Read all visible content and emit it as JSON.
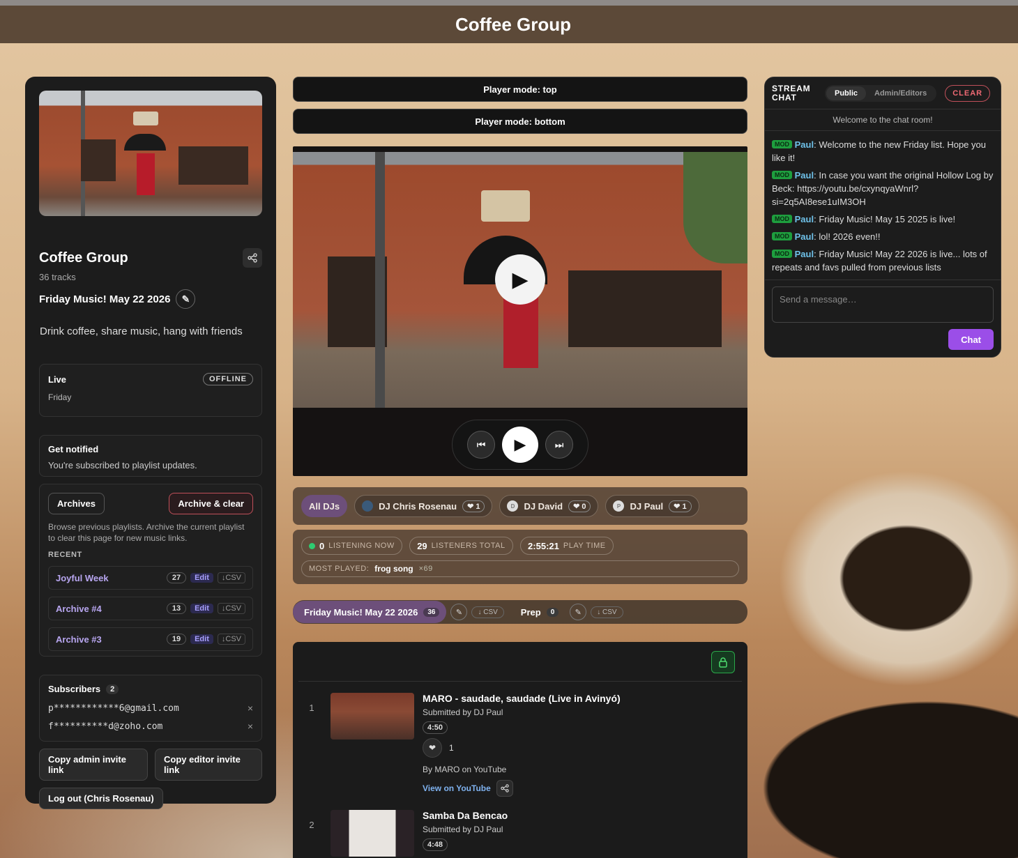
{
  "header": {
    "title": "Coffee Group"
  },
  "group": {
    "name": "Coffee Group",
    "track_count": "36 tracks",
    "playlist_title": "Friday Music! May 22 2026",
    "description": "Drink coffee, share music, hang with friends"
  },
  "live": {
    "label": "Live",
    "status": "OFFLINE",
    "day": "Friday"
  },
  "notify": {
    "title": "Get notified",
    "text": "You're subscribed to playlist updates."
  },
  "archives": {
    "archives_button": "Archives",
    "archive_clear_button": "Archive & clear",
    "help": "Browse previous playlists. Archive the current playlist to clear this page for new music links.",
    "recent_label": "RECENT",
    "items": [
      {
        "name": "Joyful Week",
        "count": "27",
        "edit": "Edit",
        "csv": "↓CSV"
      },
      {
        "name": "Archive #4",
        "count": "13",
        "edit": "Edit",
        "csv": "↓CSV"
      },
      {
        "name": "Archive #3",
        "count": "19",
        "edit": "Edit",
        "csv": "↓CSV"
      }
    ]
  },
  "subscribers": {
    "title": "Subscribers",
    "count": "2",
    "emails": [
      "p************6@gmail.com",
      "f**********d@zoho.com"
    ],
    "remove": "×"
  },
  "actions": {
    "copy_admin": "Copy admin invite link",
    "copy_editor": "Copy editor invite link",
    "logout": "Log out (Chris Rosenau)"
  },
  "player": {
    "mode_top": "Player mode: top",
    "mode_bottom": "Player mode: bottom"
  },
  "djs": {
    "all": "All DJs",
    "list": [
      {
        "name": "DJ Chris Rosenau",
        "likes": "❤ 1",
        "avatar": ""
      },
      {
        "name": "DJ David",
        "likes": "❤ 0",
        "avatar": "D"
      },
      {
        "name": "DJ Paul",
        "likes": "❤ 1",
        "avatar": "P"
      }
    ]
  },
  "stats": {
    "listening_now_value": "0",
    "listening_now_label": "LISTENING NOW",
    "listeners_total_value": "29",
    "listeners_total_label": "LISTENERS TOTAL",
    "play_time_value": "2:55:21",
    "play_time_label": "PLAY TIME",
    "most_played_label": "MOST PLAYED:",
    "most_played_title": "frog song",
    "most_played_count": "×69"
  },
  "tabs": {
    "current": {
      "label": "Friday Music! May 22 2026",
      "count": "36",
      "csv": "↓ CSV"
    },
    "prep": {
      "label": "Prep",
      "count": "0",
      "csv": "↓ CSV"
    }
  },
  "tracks": [
    {
      "num": "1",
      "title": "MARO - saudade, saudade (Live in Avinyó)",
      "submitted": "Submitted by DJ Paul",
      "duration": "4:50",
      "likes": "1",
      "by": "By MARO on YouTube",
      "link": "View on YouTube"
    },
    {
      "num": "2",
      "title": "Samba Da Bencao",
      "submitted": "Submitted by DJ Paul",
      "duration": "4:48"
    }
  ],
  "chat": {
    "title": "STREAM CHAT",
    "tab_public": "Public",
    "tab_admin": "Admin/Editors",
    "clear": "CLEAR",
    "welcome": "Welcome to the chat room!",
    "mod_badge": "MOD",
    "messages": [
      {
        "user": "Paul",
        "text": "Welcome to the new Friday list. Hope you like it!"
      },
      {
        "user": "Paul",
        "text": "In case you want the original Hollow Log by Beck: https://youtu.be/cxynqyaWnrl?si=2q5AI8ese1uIM3OH"
      },
      {
        "user": "Paul",
        "text": "Friday Music! May 15 2025 is live!"
      },
      {
        "user": "Paul",
        "text": "lol! 2026 even!!"
      },
      {
        "user": "Paul",
        "text": "Friday Music! May 22 2026 is live... lots of repeats and favs pulled from previous lists"
      }
    ],
    "placeholder": "Send a message…",
    "send": "Chat"
  },
  "colors": {
    "accent": "#9b4ee8",
    "selected_tab": "#6d4f7a",
    "mod": "#1e9e3e",
    "offline_border": "#777777"
  }
}
